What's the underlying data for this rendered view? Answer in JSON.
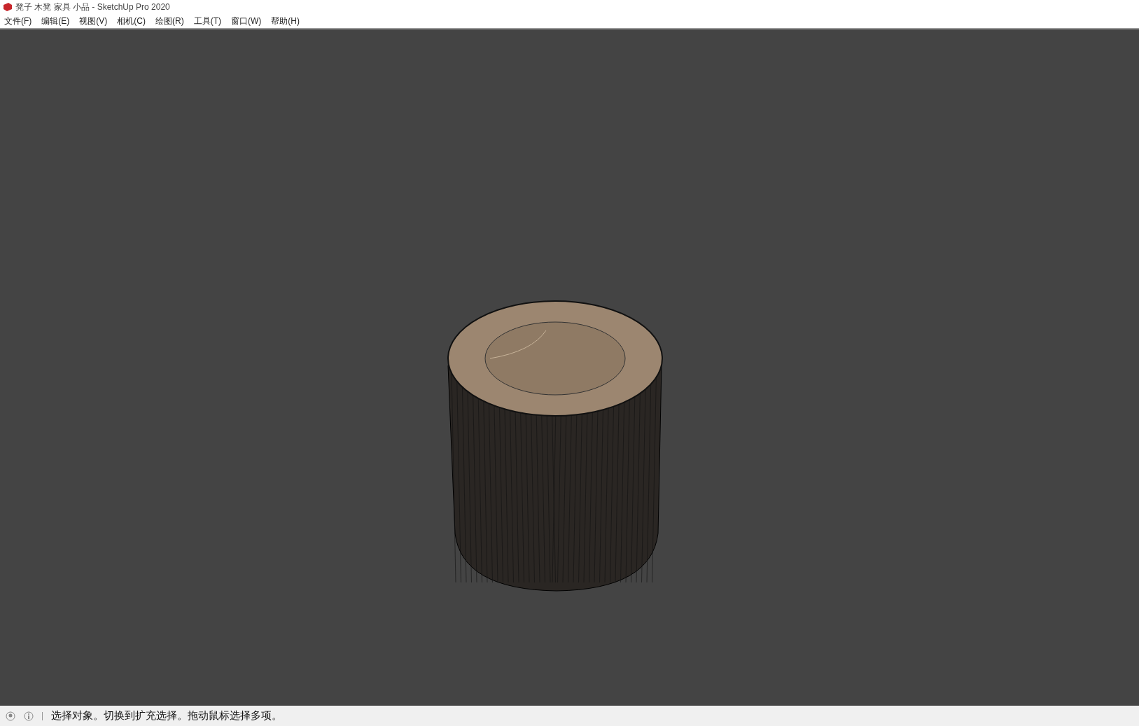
{
  "window": {
    "title": "凳子 木凳 家具 小品 - SketchUp Pro 2020"
  },
  "menu": [
    "文件(F)",
    "编辑(E)",
    "视图(V)",
    "相机(C)",
    "绘图(R)",
    "工具(T)",
    "窗口(W)",
    "帮助(H)"
  ],
  "status_bar": {
    "message": "选择对象。切换到扩充选择。拖动鼠标选择多项。"
  }
}
